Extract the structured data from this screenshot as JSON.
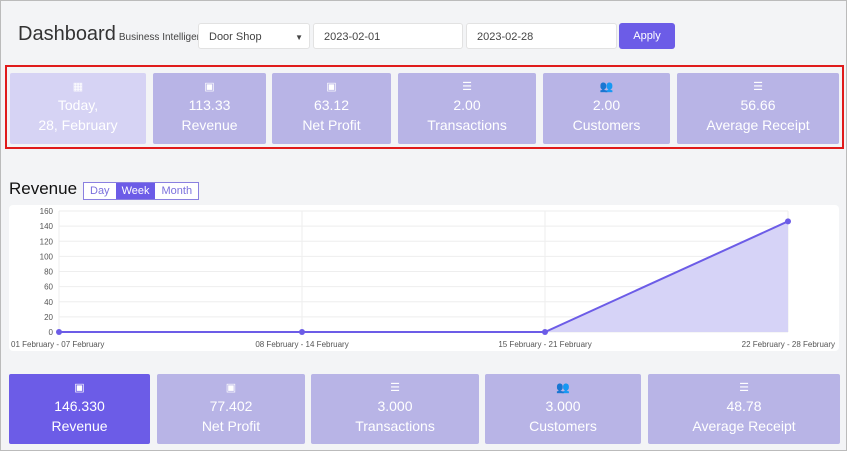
{
  "header": {
    "title": "Dashboard",
    "subtitle": "Business Intelligence",
    "shop": "Door Shop",
    "date_from": "2023-02-01",
    "date_to": "2023-02-28",
    "apply": "Apply"
  },
  "today_cards": [
    {
      "icon": "calendar-icon",
      "value": "Today,",
      "label": "28, February"
    },
    {
      "icon": "money-icon",
      "value": "113.33",
      "label": "Revenue"
    },
    {
      "icon": "money-icon",
      "value": "63.12",
      "label": "Net Profit"
    },
    {
      "icon": "list-icon",
      "value": "2.00",
      "label": "Transactions"
    },
    {
      "icon": "users-icon",
      "value": "2.00",
      "label": "Customers"
    },
    {
      "icon": "list-icon",
      "value": "56.66",
      "label": "Average Receipt"
    }
  ],
  "revenue": {
    "title": "Revenue",
    "periods": [
      "Day",
      "Week",
      "Month"
    ],
    "selected": "Week"
  },
  "chart_data": {
    "type": "area",
    "categories": [
      "01 February  - 07 February",
      "08 February  - 14 February",
      "15 February  - 21 February",
      "22 February  - 28 February"
    ],
    "values": [
      0,
      0,
      0,
      146.33
    ],
    "ylim": [
      0,
      160
    ],
    "yticks": [
      0,
      20,
      40,
      60,
      80,
      100,
      120,
      140,
      160
    ],
    "grid": true,
    "colors": {
      "line": "#6c5ce7",
      "fill": "#d6d3f7"
    }
  },
  "period_cards": [
    {
      "icon": "money-icon",
      "value": "146.330",
      "label": "Revenue"
    },
    {
      "icon": "money-icon",
      "value": "77.402",
      "label": "Net Profit"
    },
    {
      "icon": "list-icon",
      "value": "3.000",
      "label": "Transactions"
    },
    {
      "icon": "users-icon",
      "value": "3.000",
      "label": "Customers"
    },
    {
      "icon": "list-icon",
      "value": "48.78",
      "label": "Average Receipt"
    }
  ]
}
